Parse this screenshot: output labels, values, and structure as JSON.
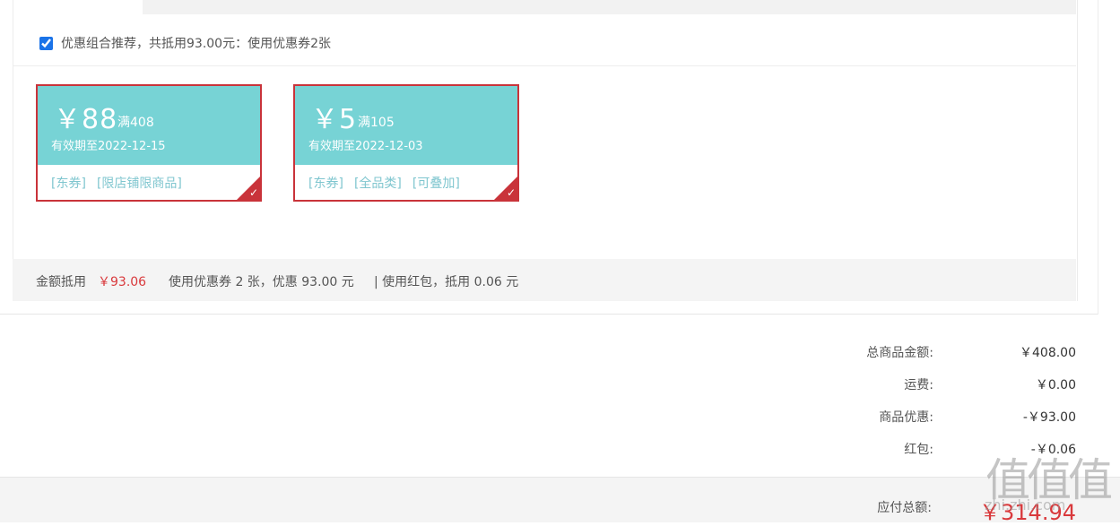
{
  "recommend": {
    "checked": true,
    "text": "优惠组合推荐，共抵用93.00元：使用优惠券2张"
  },
  "coupons": [
    {
      "currency": "￥",
      "amount": "88",
      "min": "满408",
      "expiry": "有效期至2022-12-15",
      "tags": [
        "[东券]",
        "[限店铺限商品]"
      ],
      "selected": true
    },
    {
      "currency": "￥",
      "amount": "5",
      "min": "满105",
      "expiry": "有效期至2022-12-03",
      "tags": [
        "[东券]",
        "[全品类]",
        "[可叠加]"
      ],
      "selected": true
    }
  ],
  "summary_bar": {
    "deduct_label": "金额抵用",
    "deduct_value": "￥93.06",
    "coupon_text": "使用优惠券 2 张，优惠 93.00 元",
    "redpacket_text": "| 使用红包，抵用 0.06 元"
  },
  "totals": [
    {
      "label": "总商品金额:",
      "value": "￥408.00"
    },
    {
      "label": "运费:",
      "value": "￥0.00"
    },
    {
      "label": "商品优惠:",
      "value": "-￥93.00"
    },
    {
      "label": "红包:",
      "value": "-￥0.06"
    }
  ],
  "payable": {
    "label": "应付总额:",
    "value": "￥314.94"
  },
  "watermark": {
    "logo": "值值值",
    "site": "zhi.zhi.com"
  },
  "colors": {
    "coupon_head": "#77d3d5",
    "coupon_border": "#c9333a",
    "price_red": "#d9393c"
  }
}
